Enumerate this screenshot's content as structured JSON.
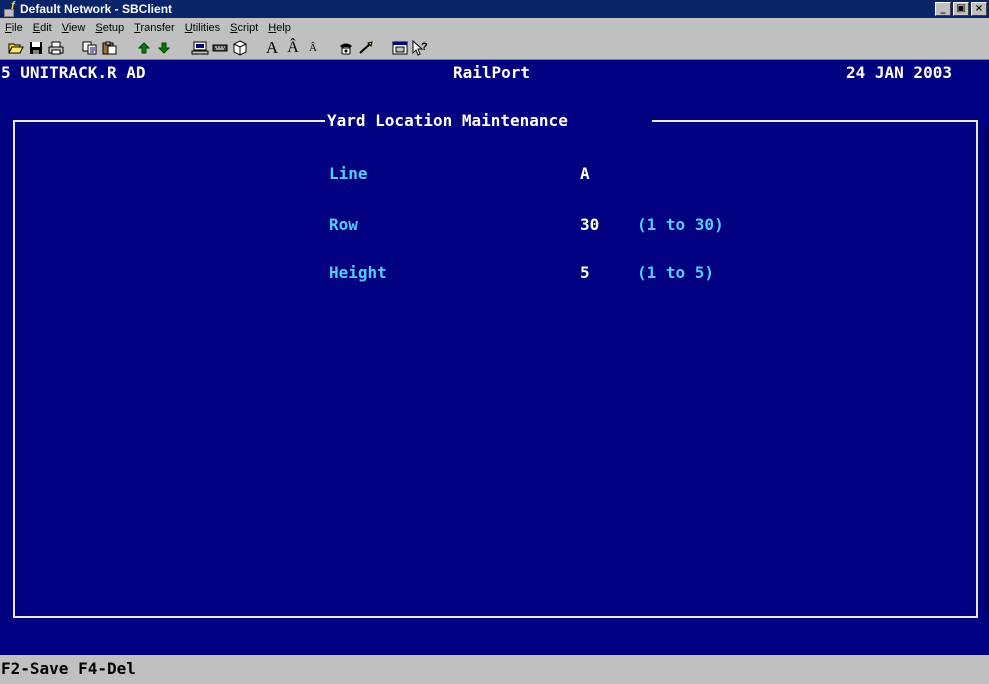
{
  "window": {
    "title": "Default Network - SBClient",
    "minimize": "_",
    "restore": "▣",
    "close": "×"
  },
  "menu": [
    {
      "label": "File"
    },
    {
      "label": "Edit"
    },
    {
      "label": "View"
    },
    {
      "label": "Setup"
    },
    {
      "label": "Transfer"
    },
    {
      "label": "Utilities"
    },
    {
      "label": "Script"
    },
    {
      "label": "Help"
    }
  ],
  "toolbar": {
    "icons": [
      "open-icon",
      "save-icon",
      "print-icon",
      "copy-icon",
      "paste-icon",
      "upload-arrow-icon",
      "download-arrow-icon",
      "terminal-icon",
      "keyboard-icon",
      "cube-icon",
      "font-large-icon",
      "font-increase-icon",
      "font-decrease-icon",
      "phone-icon",
      "hangup-icon",
      "window-icon",
      "help-pointer-icon"
    ],
    "font_large": "A",
    "font_increase": "Â",
    "font_decrease": "Â"
  },
  "terminal": {
    "header_left": "5 UNITRACK.R AD",
    "header_center": "RailPort",
    "header_right": "24 JAN 2003",
    "screen_title": "Yard Location Maintenance",
    "fields": [
      {
        "label": "Line",
        "value": "A",
        "range": ""
      },
      {
        "label": "Row",
        "value": "30",
        "range": "(1 to 30)"
      },
      {
        "label": "Height",
        "value": "5",
        "range": "(1 to 5)"
      }
    ],
    "function_keys": "F2-Save F4-Del"
  },
  "colors": {
    "screen_bg": "#000080",
    "label": "#55ccff",
    "value": "#ffffff"
  }
}
